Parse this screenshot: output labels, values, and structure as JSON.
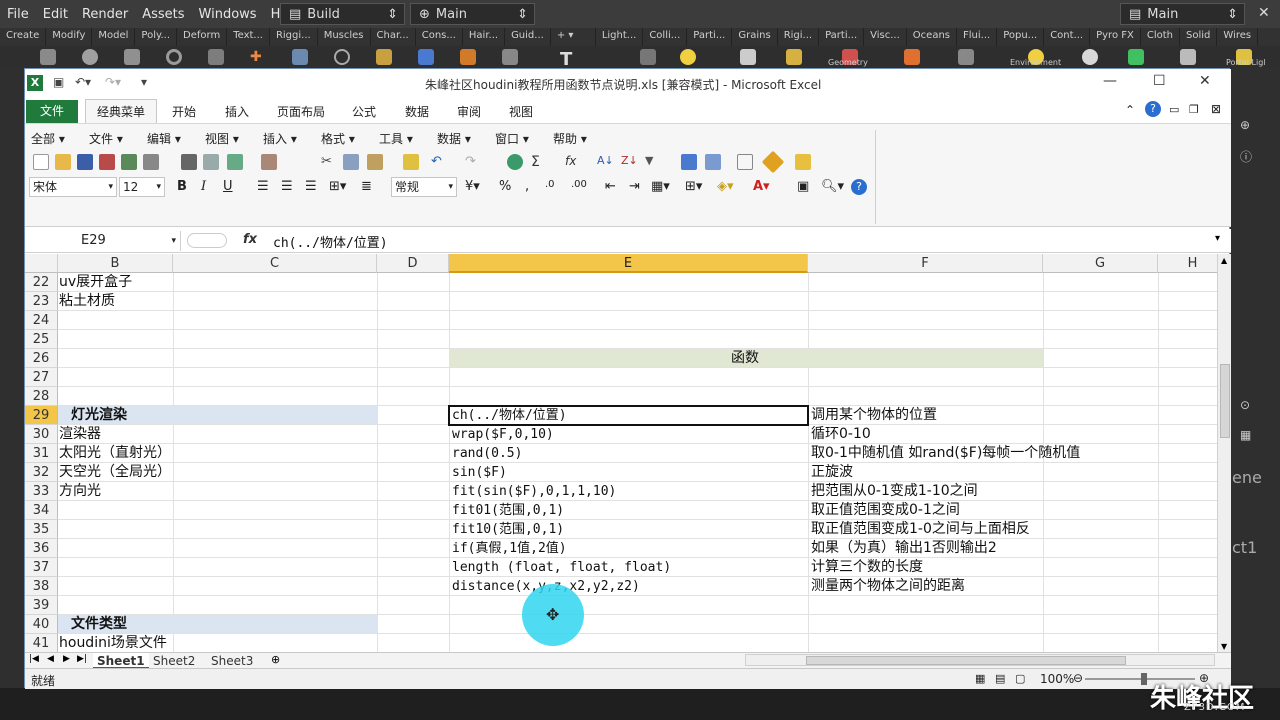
{
  "colors": {
    "excel_green": "#1f7a3c",
    "selection_header": "#f3c64a",
    "section_fill": "#dbe5f1",
    "title_fill": "#e0e8d4",
    "cursor_highlight": "#30d6f0"
  },
  "houdini": {
    "menu": [
      "File",
      "Edit",
      "Render",
      "Assets",
      "Windows",
      "Help"
    ],
    "build_desk": "Build",
    "network_main": "Main",
    "pane_main": "Main",
    "shelf_tabs_left": [
      "Create",
      "Modify",
      "Model",
      "Poly...",
      "Deform",
      "Text...",
      "Riggi...",
      "Muscles",
      "Char...",
      "Cons...",
      "Hair...",
      "Guid..."
    ],
    "shelf_tabs_right": [
      "Light...",
      "Colli...",
      "Parti...",
      "Grains",
      "Rigi...",
      "Parti...",
      "Visc...",
      "Oceans",
      "Flui...",
      "Popu...",
      "Cont...",
      "Pyro FX",
      "Cloth",
      "Solid",
      "Wires"
    ],
    "shelf_fragment_geometry": "Geometry",
    "shelf_fragment_environment": "Environment",
    "shelf_fragment_portal": "Portal Ligl",
    "scene_label": "ct1",
    "scene_fragment": "ene"
  },
  "watermark": {
    "brand": "朱峰社区",
    "domain": "ZF3D.COM"
  },
  "excel": {
    "title": "朱峰社区houdini教程所用函数节点说明.xls  [兼容模式]  -  Microsoft Excel",
    "file_tab": "文件",
    "ribbon_tabs": [
      "经典菜单",
      "开始",
      "插入",
      "页面布局",
      "公式",
      "数据",
      "审阅",
      "视图"
    ],
    "classic_menu": [
      "全部",
      "文件",
      "编辑",
      "视图",
      "插入",
      "格式",
      "工具",
      "数据",
      "窗口",
      "帮助"
    ],
    "font_name": "宋体",
    "font_size": "12",
    "number_format": "常规",
    "name_box": "E29",
    "fx_label": "fx",
    "formula": "ch(../物体/位置)",
    "columns": [
      "B",
      "C",
      "D",
      "E",
      "F",
      "G",
      "H"
    ],
    "selected_column": "E",
    "selected_row": "29",
    "rows": [
      "22",
      "23",
      "24",
      "25",
      "26",
      "27",
      "28",
      "29",
      "30",
      "31",
      "32",
      "33",
      "34",
      "35",
      "36",
      "37",
      "38",
      "39",
      "40",
      "41"
    ],
    "cells": {
      "B22": "uv展开盒子",
      "B23": "粘土材质",
      "B29": "灯光渲染",
      "B30": "渲染器",
      "B31": "太阳光（直射光）",
      "B32": "天空光（全局光）",
      "B33": "方向光",
      "B40": "文件类型",
      "B41": "houdini场景文件",
      "E26": "函数",
      "E29": "ch(../物体/位置)",
      "E30": "wrap($F,0,10)",
      "E31": "rand(0.5)",
      "E32": "sin($F)",
      "E33": "fit(sin($F),0,1,1,10)",
      "E34": "fit01(范围,0,1)",
      "E35": "fit10(范围,0,1)",
      "E36": "if(真假,1值,2值)",
      "E37": "length (float, float, float)",
      "E38": "distance(x,y,z,x2,y2,z2)",
      "F29": "调用某个物体的位置",
      "F30": "循环0-10",
      "F31": "取0-1中随机值 如rand($F)每帧一个随机值",
      "F32": "正旋波",
      "F33": "把范围从0-1变成1-10之间",
      "F34": "取正值范围变成0-1之间",
      "F35": "取正值范围变成1-0之间与上面相反",
      "F36": "如果（为真）输出1否则输出2",
      "F37": "计算三个数的长度",
      "F38": "测量两个物体之间的距离"
    },
    "sheets": [
      "Sheet1",
      "Sheet2",
      "Sheet3"
    ],
    "active_sheet": "Sheet1",
    "status": "就绪",
    "zoom": "100%"
  }
}
